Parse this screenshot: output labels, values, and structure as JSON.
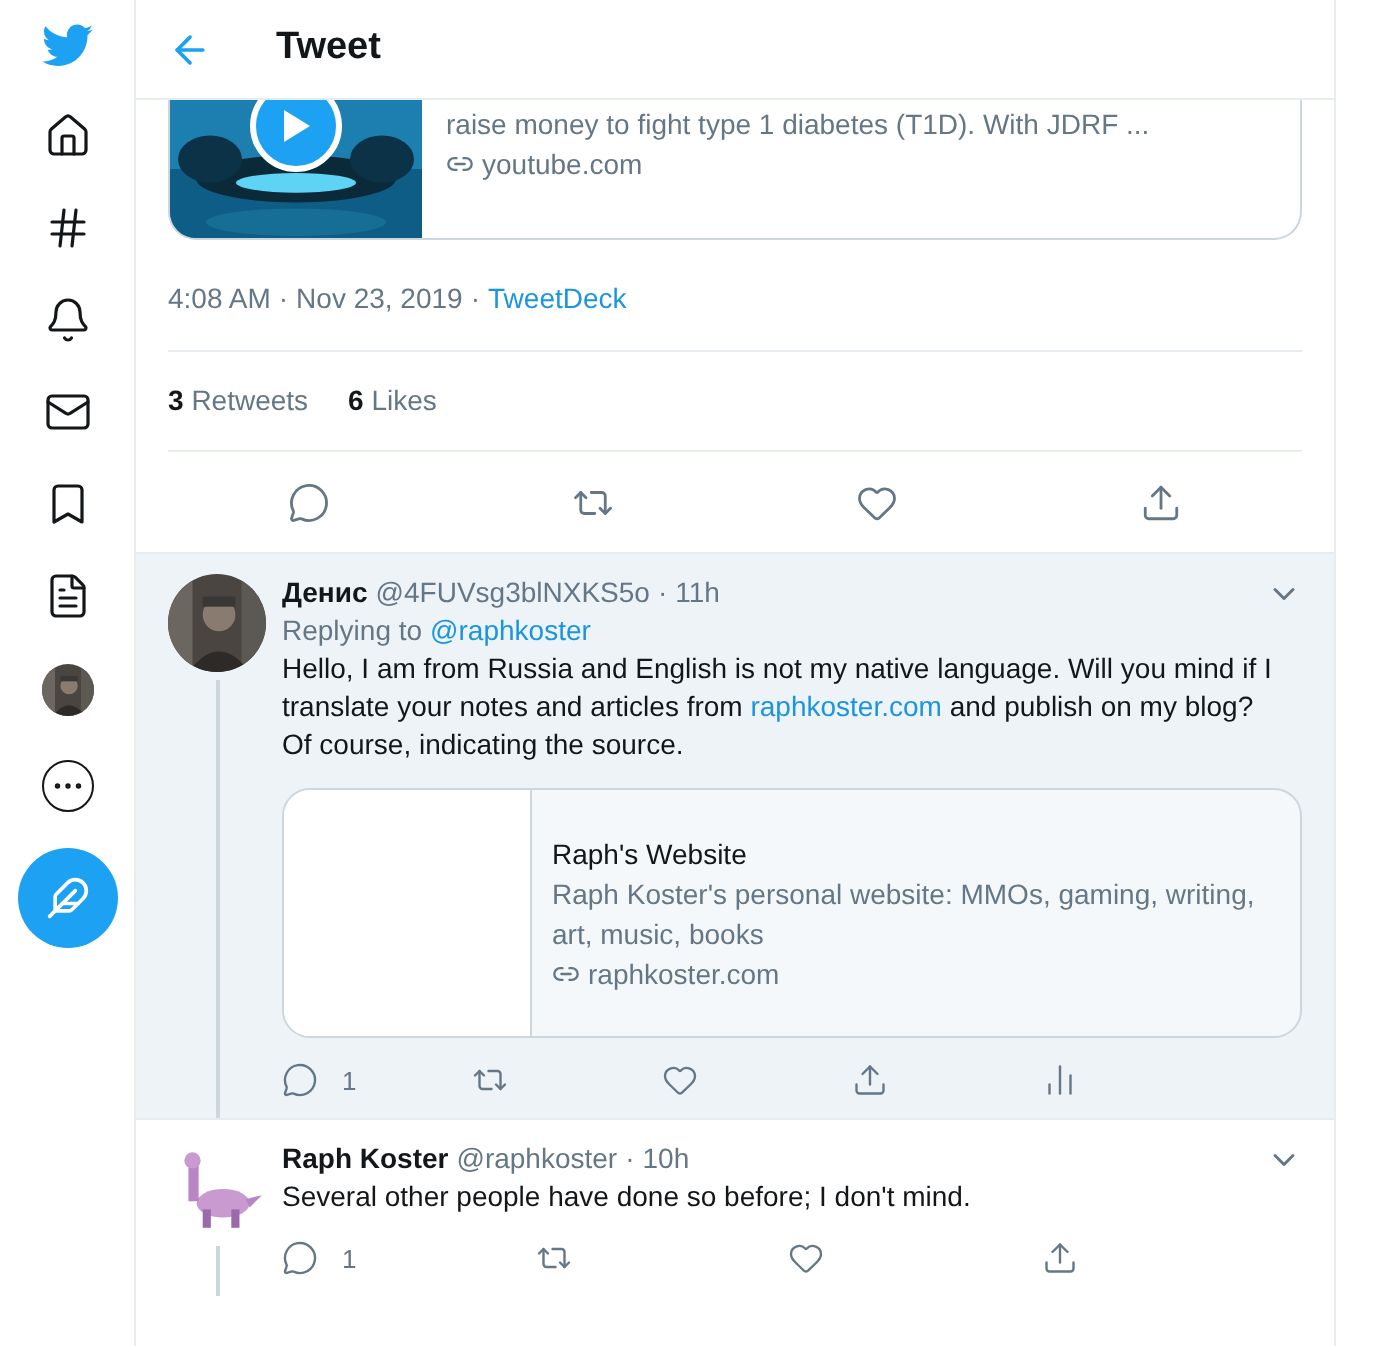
{
  "header": {
    "title": "Tweet"
  },
  "link_card": {
    "description": "raise money to fight type 1 diabetes (T1D). With JDRF ...",
    "domain": "youtube.com"
  },
  "meta": {
    "time": "4:08 AM",
    "separator": "·",
    "date": "Nov 23, 2019",
    "source_separator": "·",
    "source": "TweetDeck"
  },
  "stats": [
    {
      "count": "3",
      "label": "Retweets"
    },
    {
      "count": "6",
      "label": "Likes"
    }
  ],
  "replies": [
    {
      "name": "Денис",
      "handle": "@4FUVsg3blNXKS5o",
      "separator": "·",
      "time": "11h",
      "highlighted": true,
      "replying_to": {
        "prefix": "Replying to",
        "handle": "@raphkoster"
      },
      "paragraphs": [
        [
          {
            "kind": "plain",
            "text": "Hello, I am from Russia and English is not my native language. Will you mind if I translate your notes and articles from "
          },
          {
            "kind": "link",
            "text": "raphkoster.com"
          },
          {
            "kind": "plain",
            "text": " and publish on my blog?"
          }
        ],
        [
          {
            "kind": "plain",
            "text": "Of course, indicating the source."
          }
        ]
      ],
      "card": {
        "title": "Raph's Website",
        "description": "Raph Koster's personal website: MMOs, gaming, writing, art, music, books",
        "domain": "raphkoster.com"
      },
      "actions": [
        {
          "kind": "reply",
          "count": "1"
        },
        {
          "kind": "retweet"
        },
        {
          "kind": "like"
        },
        {
          "kind": "share"
        },
        {
          "kind": "analytics"
        }
      ]
    },
    {
      "name": "Raph Koster",
      "handle": "@raphkoster",
      "separator": "·",
      "time": "10h",
      "highlighted": false,
      "paragraphs": [
        [
          {
            "kind": "plain",
            "text": "Several other people have done so before; I don't mind."
          }
        ]
      ],
      "actions": [
        {
          "kind": "reply",
          "count": "1"
        },
        {
          "kind": "retweet"
        },
        {
          "kind": "like"
        },
        {
          "kind": "share"
        }
      ]
    }
  ]
}
